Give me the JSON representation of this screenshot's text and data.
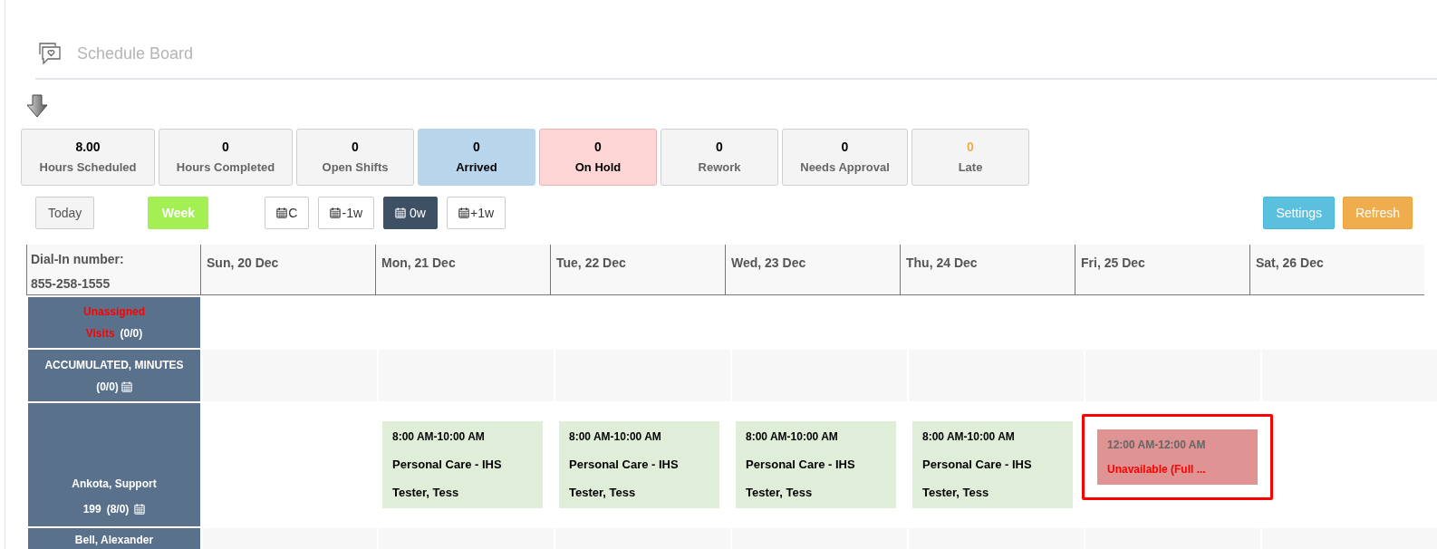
{
  "page": {
    "title": "Schedule Board"
  },
  "stats": [
    {
      "value": "8.00",
      "label": "Hours Scheduled",
      "kind": "plain"
    },
    {
      "value": "0",
      "label": "Hours Completed",
      "kind": "plain"
    },
    {
      "value": "0",
      "label": "Open Shifts",
      "kind": "plain"
    },
    {
      "value": "0",
      "label": "Arrived",
      "kind": "arrived"
    },
    {
      "value": "0",
      "label": "On Hold",
      "kind": "on_hold"
    },
    {
      "value": "0",
      "label": "Rework",
      "kind": "plain"
    },
    {
      "value": "0",
      "label": "Needs Approval",
      "kind": "plain"
    },
    {
      "value": "0",
      "label": "Late",
      "kind": "late"
    }
  ],
  "toolbar": {
    "today": "Today",
    "view": {
      "label": "Week",
      "selected": true
    },
    "nav": [
      {
        "label": "C",
        "selected": false
      },
      {
        "label": "-1w",
        "selected": false
      },
      {
        "label": "0w",
        "selected": true
      },
      {
        "label": "+1w",
        "selected": false
      }
    ],
    "settings": "Settings",
    "refresh": "Refresh"
  },
  "board": {
    "dial_in": [
      "Dial-In number:",
      "855-258-1555"
    ],
    "days": [
      "Sun, 20 Dec",
      "Mon, 21 Dec",
      "Tue, 22 Dec",
      "Wed, 23 Dec",
      "Thu, 24 Dec",
      "Fri, 25 Dec",
      "Sat, 26 Dec"
    ],
    "rows": [
      {
        "kind": "unassigned",
        "name": [
          "Unassigned",
          "Visits"
        ],
        "count": "(0/0)",
        "cells": [
          null,
          null,
          null,
          null,
          null,
          null,
          null
        ]
      },
      {
        "kind": "summary",
        "name": [
          "ACCUMULATED, MINUTES"
        ],
        "count": "(0/0)",
        "cells": [
          null,
          null,
          null,
          null,
          null,
          null,
          null
        ]
      },
      {
        "kind": "worker",
        "name": [
          "Ankota, Support"
        ],
        "id": "199",
        "count": "(8/0)",
        "cells": [
          null,
          {
            "kind": "visit",
            "time": "8:00 AM-10:00 AM",
            "title": "Personal Care - IHS",
            "client": "Tester, Tess",
            "highlighted": false
          },
          {
            "kind": "visit",
            "time": "8:00 AM-10:00 AM",
            "title": "Personal Care - IHS",
            "client": "Tester, Tess",
            "highlighted": false
          },
          {
            "kind": "visit",
            "time": "8:00 AM-10:00 AM",
            "title": "Personal Care - IHS",
            "client": "Tester, Tess",
            "highlighted": false
          },
          {
            "kind": "visit",
            "time": "8:00 AM-10:00 AM",
            "title": "Personal Care - IHS",
            "client": "Tester, Tess",
            "highlighted": false
          },
          {
            "kind": "unavailable",
            "time": "12:00 AM-12:00 AM",
            "title": "Unavailable (Full ...",
            "highlighted": true
          },
          null
        ]
      },
      {
        "kind": "partial",
        "name": [
          "Bell, Alexander"
        ],
        "cells": [
          null,
          null,
          null,
          null,
          null,
          null,
          null
        ]
      }
    ]
  }
}
